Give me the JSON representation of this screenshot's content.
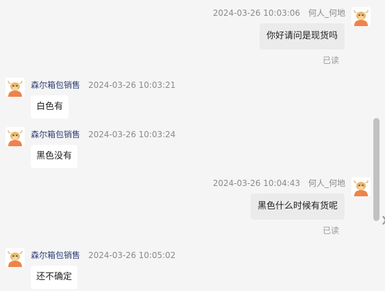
{
  "messages": [
    {
      "side": "out",
      "time": "2024-03-26 10:03:06",
      "sender": "何人_何地",
      "text": "你好请问是现货吗",
      "status": "已读"
    },
    {
      "side": "in",
      "time": "2024-03-26 10:03:21",
      "sender": "森尔箱包销售",
      "text": "白色有"
    },
    {
      "side": "in",
      "time": "2024-03-26 10:03:24",
      "sender": "森尔箱包销售",
      "text": "黑色没有"
    },
    {
      "side": "out",
      "time": "2024-03-26 10:04:43",
      "sender": "何人_何地",
      "text": "黑色什么时候有货呢",
      "status": "已读"
    },
    {
      "side": "in",
      "time": "2024-03-26 10:05:02",
      "sender": "森尔箱包销售",
      "text": "还不确定"
    }
  ],
  "icons": {
    "avatar": "cow-mascot-avatar-icon",
    "expand": "chevron-right-icon"
  },
  "colors": {
    "background": "#f5f5f5",
    "incoming_bubble": "#ffffff",
    "outgoing_bubble": "#ebebeb",
    "sender_name": "#2e3f73",
    "avatar_accent": "#f0824a"
  }
}
